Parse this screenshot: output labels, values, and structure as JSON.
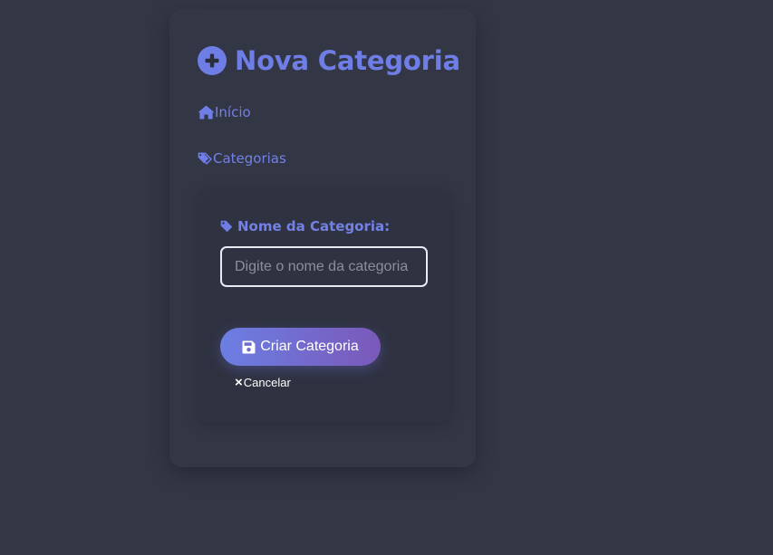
{
  "page": {
    "title": "Nova Categoria"
  },
  "nav": {
    "home_label": "Início",
    "categories_label": "Categorias",
    "home_icon": "home-icon",
    "categories_icon": "tags-icon"
  },
  "form": {
    "name_label": "Nome da Categoria:",
    "name_placeholder": "Digite o nome da categoria",
    "name_value": "",
    "submit_label": "Criar Categoria",
    "cancel_label": "Cancelar"
  },
  "colors": {
    "background": "#333645",
    "accent": "#6f7ee6",
    "button_gradient_start": "#6c7ee3",
    "button_gradient_end": "#7a59b9",
    "input_border": "#e9ebf3"
  }
}
